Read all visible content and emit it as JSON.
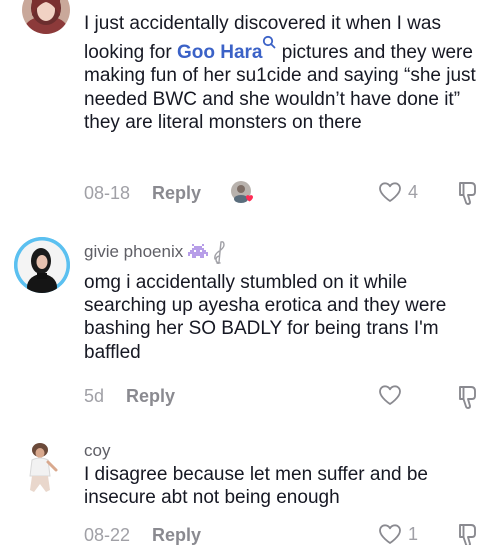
{
  "comments": [
    {
      "text_before": "I just accidentally discovered it when I was looking for ",
      "link_text": "Goo Hara",
      "text_after": " pictures and they were making fun of her su1cide and saying “she just needed BWC and she wouldn’t have done it” they are literal monsters on there",
      "date": "08-18",
      "reply_label": "Reply",
      "like_count": "4"
    },
    {
      "username": "givie phoenix",
      "badges": [
        "alien-emoji",
        "music-note-emoji"
      ],
      "text": "omg i accidentally stumbled on it while searching up ayesha erotica and they were bashing her SO BADLY for being trans I'm baffled",
      "date": "5d",
      "reply_label": "Reply",
      "like_count": ""
    },
    {
      "username": "coy",
      "text": "I disagree because let men suffer and be insecure abt not being enough",
      "date": "08-22",
      "reply_label": "Reply",
      "like_count": "1"
    }
  ],
  "colors": {
    "link": "#3b62c7",
    "meta": "#a0a0a6",
    "text": "#161823",
    "avatar_ring": "#5bc0f0",
    "creator_heart": "#fe2c55"
  }
}
